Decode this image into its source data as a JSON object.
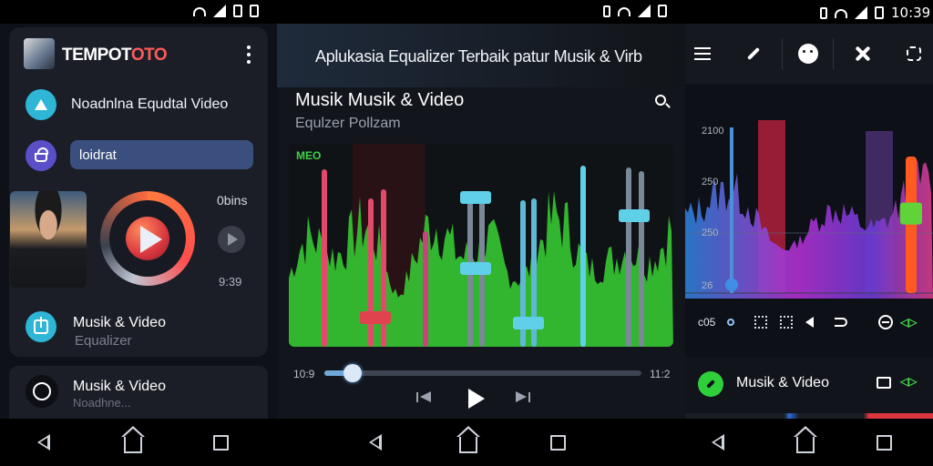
{
  "status": {
    "time": "10:39"
  },
  "left_panel": {
    "brand_part1": "TEMPOT",
    "brand_part2": "OTO",
    "row1_label": "Noadnlna Equdtal Video",
    "search_value": "loidrat",
    "time_top": "0bins",
    "time_bottom": "9:39",
    "row3_title": "Musik & Video",
    "row3_subtitle": "Equalizer",
    "card2_title": "Musik & Video",
    "card2_subtitle": "Noadhne..."
  },
  "center_panel": {
    "headline": "Aplukasia Equalizer Terbaik patur Musik & Virb",
    "title": "Musik Musik & Video",
    "subtitle": "Equlzer Pollzam",
    "eq_mode": "MEO",
    "time_start": "10:9",
    "time_end": "11:2",
    "seek_progress": 0.09,
    "accent": "#5fd0e8",
    "wave_color": "#36c832"
  },
  "right_panel": {
    "y_labels": [
      "2100",
      "250",
      "250",
      "26"
    ],
    "icon_row_label": "c05",
    "track_title": "Musik & Video",
    "arrow_label": "◁▷",
    "slider_left_level": 0.05,
    "slider_right_level": 0.48
  },
  "icons": {
    "menu": "menu-icon",
    "edit": "pencil-icon",
    "face": "smiley-icon",
    "tools": "crossed-tools-icon",
    "rotate": "rotate-icon"
  }
}
